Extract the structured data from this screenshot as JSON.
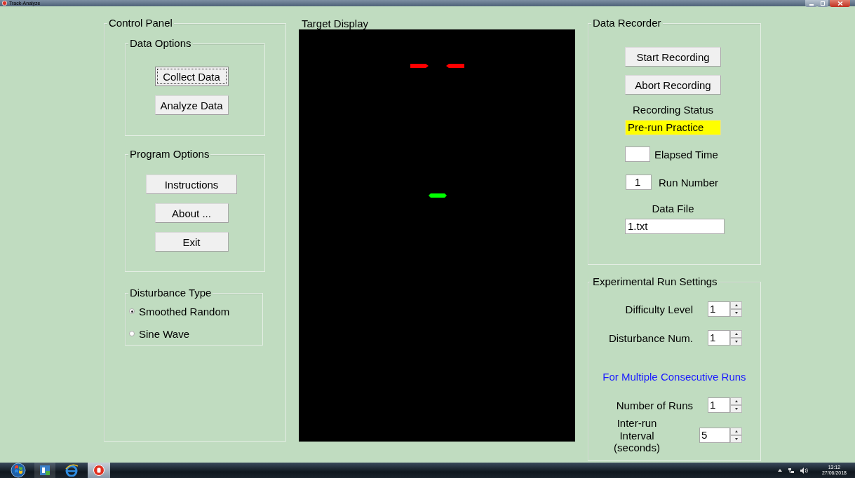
{
  "window": {
    "title": "Track-Analyze"
  },
  "control_panel": {
    "title": "Control Panel",
    "data_options": {
      "title": "Data Options",
      "buttons": [
        {
          "label": "Collect Data",
          "focused": true
        },
        {
          "label": "Analyze Data",
          "focused": false
        }
      ]
    },
    "program_options": {
      "title": "Program Options",
      "buttons": [
        {
          "label": "Instructions",
          "focused": false
        },
        {
          "label": "About ...",
          "focused": false
        },
        {
          "label": "Exit",
          "focused": false
        }
      ]
    },
    "disturbance_type": {
      "title": "Disturbance Type",
      "options": [
        {
          "label": "Smoothed Random",
          "selected": true
        },
        {
          "label": "Sine Wave",
          "selected": false
        }
      ]
    }
  },
  "target_display": {
    "title": "Target Display"
  },
  "data_recorder": {
    "title": "Data Recorder",
    "buttons": [
      "Start Recording",
      "Abort Recording"
    ],
    "status_label": "Recording Status",
    "status_value": "Pre-run Practice",
    "elapsed_time": {
      "label": "Elapsed Time"
    },
    "run_number": {
      "label": "Run Number",
      "value": "1"
    },
    "data_file": {
      "label": "Data File",
      "value": "1.txt"
    }
  },
  "run_settings": {
    "title": "Experimental Run Settings",
    "spinners": [
      {
        "label": "Difficulty Level",
        "value": "1"
      },
      {
        "label": "Disturbance Num.",
        "value": "1"
      }
    ],
    "note": "For Multiple Consecutive Runs",
    "multi_spinners": [
      {
        "label": "Number of Runs",
        "value": "1"
      },
      {
        "label": "Inter-run Interval (seconds)",
        "value": "5"
      }
    ]
  },
  "taskbar": {
    "time": "13:12",
    "date": "27/06/2018"
  }
}
